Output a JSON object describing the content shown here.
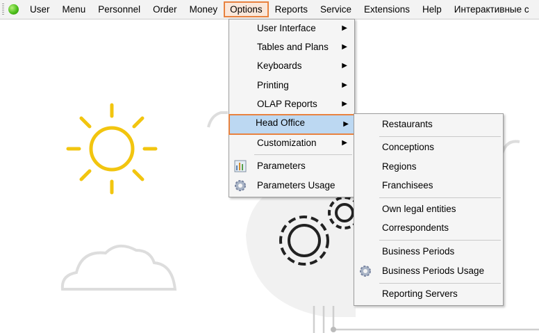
{
  "menubar": {
    "items": [
      "User",
      "Menu",
      "Personnel",
      "Order",
      "Money",
      "Options",
      "Reports",
      "Service",
      "Extensions",
      "Help",
      "Интерактивные с"
    ],
    "selected": "Options"
  },
  "options_menu": {
    "items": [
      {
        "label": "User Interface",
        "submenu": true
      },
      {
        "label": "Tables and Plans",
        "submenu": true
      },
      {
        "label": "Keyboards",
        "submenu": true
      },
      {
        "label": "Printing",
        "submenu": true
      },
      {
        "label": "OLAP Reports",
        "submenu": true
      },
      {
        "label": "Head Office",
        "submenu": true,
        "highlighted": true
      },
      {
        "label": "Customization",
        "submenu": true
      },
      {
        "label": "Parameters",
        "icon": "parameters-icon"
      },
      {
        "label": "Parameters Usage",
        "icon": "gear-icon"
      }
    ]
  },
  "head_office_menu": {
    "items": [
      {
        "label": "Restaurants"
      },
      {
        "label": "Conceptions"
      },
      {
        "label": "Regions"
      },
      {
        "label": "Franchisees"
      },
      {
        "label": "Own legal entities"
      },
      {
        "label": "Correspondents"
      },
      {
        "label": "Business Periods"
      },
      {
        "label": "Business Periods Usage",
        "icon": "gear-icon"
      },
      {
        "label": "Reporting Servers"
      }
    ]
  },
  "colors": {
    "highlight": "#bcd8f2",
    "focus_border": "#e8823f",
    "sun": "#f2c50f"
  }
}
